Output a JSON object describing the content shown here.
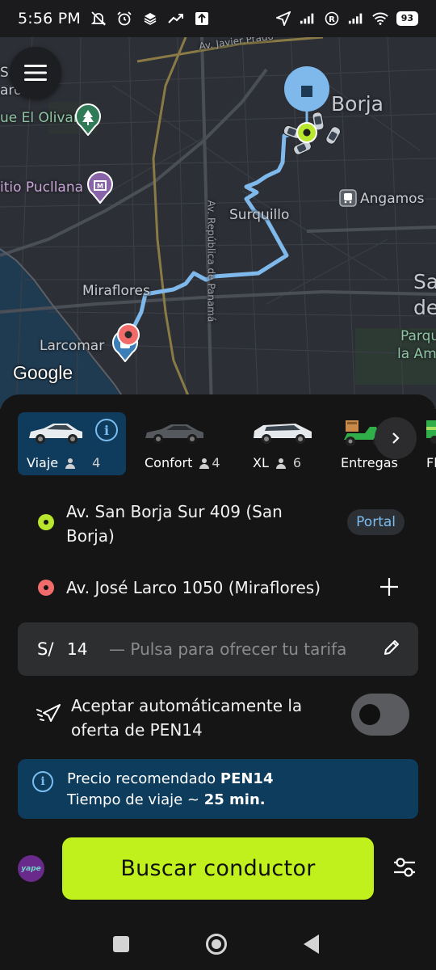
{
  "status_bar": {
    "time": "5:56 PM",
    "battery": "93",
    "icons_left": [
      "mute-icon",
      "alarm-icon",
      "stack-icon",
      "trend-icon",
      "upload-icon"
    ],
    "icons_right": [
      "location-icon",
      "signal-icon",
      "r-icon",
      "signal-icon",
      "wifi-icon",
      "battery-icon"
    ]
  },
  "map": {
    "labels": {
      "olivar": "ue El Olivar",
      "pucllana": "itio Pucllana",
      "borja": "Borja",
      "angamos": "Angamos",
      "surquillo": "Surquillo",
      "miraflores": "Miraflores",
      "larcomar": "Larcomar",
      "san_1": "Sa",
      "san_2": "de",
      "parque_1": "Parqu",
      "parque_2": "la Am",
      "road_javier": "Av. Javier Prado",
      "road_panama": "Av. República de Panamá",
      "top_left_1": "S",
      "top_left_2": "aro"
    },
    "google": "Google"
  },
  "tariffs": [
    {
      "label": "Viaje",
      "count": "4",
      "active": true
    },
    {
      "label": "Confort",
      "count": "4",
      "active": false
    },
    {
      "label": "XL",
      "count": "6",
      "active": false
    },
    {
      "label": "Entregas",
      "count": "",
      "active": false
    },
    {
      "label": "Fle",
      "count": "",
      "active": false
    }
  ],
  "route": {
    "origin_line1": "Av. San Borja Sur 409 (San",
    "origin_line2": "Borja)",
    "origin_badge": "Portal",
    "destination": "Av. José Larco 1050 (Miraflores)",
    "colors": {
      "origin": "#b8e62c",
      "destination": "#f26b6b"
    }
  },
  "fare": {
    "currency": "S/",
    "amount": "14",
    "hint": "— Pulsa para ofrecer tu tarifa"
  },
  "auto_accept": {
    "line1": "Aceptar automáticamente la",
    "line2": "oferta de PEN14",
    "enabled": false
  },
  "banner": {
    "price_prefix": "Precio recomendado ",
    "price_value": "PEN14",
    "time_prefix": "Tiempo de viaje ~ ",
    "time_value": "25 min."
  },
  "actions": {
    "yape": "yape",
    "search_label": "Buscar conductor"
  },
  "colors": {
    "accent": "#c1f11d",
    "info_blue": "#0e3c5c",
    "link_blue": "#7bbdf0"
  }
}
